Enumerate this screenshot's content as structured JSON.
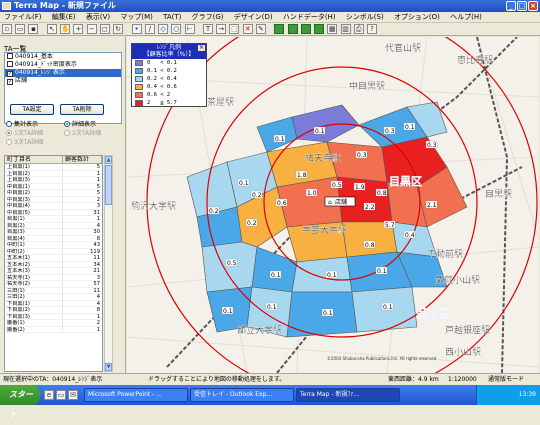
{
  "window": {
    "title": "Terra Map - 新規ファイル",
    "minimize": "_",
    "maximize": "□",
    "close": "×"
  },
  "menu": [
    "ファイル(F)",
    "編集(E)",
    "表示(V)",
    "マップ(M)",
    "TA(T)",
    "グラフ(G)",
    "デザイン(D)",
    "ハンドデータ(H)",
    "シンボル(S)",
    "オプション(O)",
    "ヘルプ(H)"
  ],
  "left_panel": {
    "title": "TA一覧",
    "ta_list": [
      {
        "label": "040914_基本",
        "checked": false,
        "selected": false
      },
      {
        "label": "040914_ﾄﾞｯﾄ密度表示",
        "checked": false,
        "selected": false
      },
      {
        "label": "040914_ﾚﾝｼﾞ表示",
        "checked": true,
        "selected": true
      },
      {
        "label": "店舗",
        "checked": true,
        "selected": false
      }
    ],
    "btn_ta_settings": "TA設定",
    "btn_ta_delete": "TA削除",
    "radio_summary": "集計表示",
    "radio_detail": "詳細表示",
    "radio_first": "1次TA詳細",
    "radio_second": "2次TA詳細",
    "radio_third": "3次TA詳細",
    "grid_headers": [
      "町丁目名",
      "顧客数計"
    ],
    "grid_rows": [
      [
        "上目黒(1)",
        "5"
      ],
      [
        "上目黒(2)",
        "1"
      ],
      [
        "上目黒(3)",
        "1"
      ],
      [
        "中目黒(1)",
        "5"
      ],
      [
        "中目黒(2)",
        "5"
      ],
      [
        "中目黒(3)",
        "2"
      ],
      [
        "中目黒(4)",
        "3"
      ],
      [
        "中目黒(5)",
        "31"
      ],
      [
        "目黒(1)",
        "1"
      ],
      [
        "目黒(2)",
        "4"
      ],
      [
        "目黒(3)",
        "30"
      ],
      [
        "目黒(4)",
        "8"
      ],
      [
        "中町(1)",
        "43"
      ],
      [
        "中町(2)",
        "119"
      ],
      [
        "五本木(1)",
        "11"
      ],
      [
        "五本木(2)",
        "34"
      ],
      [
        "五本木(3)",
        "21"
      ],
      [
        "祐天寺(1)",
        "3"
      ],
      [
        "祐天寺(2)",
        "57"
      ],
      [
        "三田(1)",
        "11"
      ],
      [
        "三田(2)",
        "4"
      ],
      [
        "下目黒(1)",
        "4"
      ],
      [
        "下目黒(2)",
        "8"
      ],
      [
        "下目黒(3)",
        "1"
      ],
      [
        "鷹番(1)",
        "2"
      ],
      [
        "鷹番(2)",
        "1"
      ]
    ]
  },
  "legend": {
    "title_line1": "ﾚﾝｼﾞ凡例",
    "title_line2": "【顧客比率（%）】",
    "close": "×",
    "rows": [
      {
        "range": "0   < 0.1",
        "color": "#7b7bd8"
      },
      {
        "range": "0.1 < 0.2",
        "color": "#4aa8e8"
      },
      {
        "range": "0.2 < 0.4",
        "color": "#a8d8f0"
      },
      {
        "range": "0.4 < 0.6",
        "color": "#f8b040"
      },
      {
        "range": "0.6 < 2",
        "color": "#f07050"
      },
      {
        "range": "2   ≦ 5.7",
        "color": "#e82020"
      }
    ]
  },
  "map": {
    "stations": [
      "代官山駅",
      "恵比寿駅",
      "中目黒駅",
      "三軒茶屋駅",
      "祐天寺駅",
      "目黒区",
      "目黒駅",
      "駒沢大学駅",
      "学芸大学駅",
      "不動前駅",
      "武蔵小山駅",
      "品川区",
      "戸越銀座駅",
      "都立大学駅",
      "西小山駅"
    ],
    "store_label": "店舗",
    "area_values": [
      "0.1",
      "0.3",
      "0.1",
      "0.1",
      "0.3",
      "0.1",
      "0.2",
      "0.2",
      "1.8",
      "0.3",
      "0.6",
      "1.0",
      "0.5",
      "1.9",
      "0.2",
      "0.8",
      "2.2",
      "5.7",
      "2.1",
      "0.8",
      "0.4",
      "0.5",
      "0.1",
      "0.1",
      "0.1",
      "0.1",
      "0.1",
      "0.1",
      "0.1"
    ],
    "copyright": "©2004 Shobunsha Publications,Inc. All rights reserved"
  },
  "status": {
    "left": "現在選択中のTA：040914_ﾚﾝｼﾞ表示",
    "mid": "ドラッグすることにより地図の移動処理をします。",
    "scale_label": "東西距離：4.9 km",
    "zoom": "1:120000",
    "mode": "通常版モード"
  },
  "taskbar": {
    "start": "スタート",
    "tasks": [
      "Microsoft PowerPoint - ...",
      "受信トレイ - Outlook Exp...",
      "Terra Map - 新規ﾌｧ..."
    ],
    "tray_text": "13:39"
  }
}
